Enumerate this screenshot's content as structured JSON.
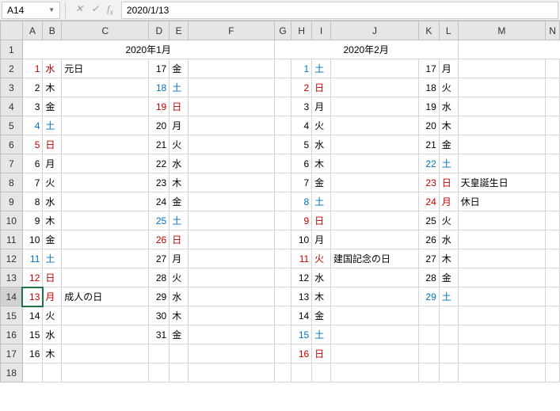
{
  "nameBox": "A14",
  "formula": "2020/1/13",
  "cols": [
    {
      "id": "A",
      "w": 26
    },
    {
      "id": "B",
      "w": 24
    },
    {
      "id": "C",
      "w": 112
    },
    {
      "id": "D",
      "w": 26
    },
    {
      "id": "E",
      "w": 24
    },
    {
      "id": "F",
      "w": 112
    },
    {
      "id": "G",
      "w": 22
    },
    {
      "id": "H",
      "w": 26
    },
    {
      "id": "I",
      "w": 24
    },
    {
      "id": "J",
      "w": 112
    },
    {
      "id": "K",
      "w": 26
    },
    {
      "id": "L",
      "w": 24
    },
    {
      "id": "M",
      "w": 112
    },
    {
      "id": "N",
      "w": 18
    }
  ],
  "rows": 18,
  "activeCell": {
    "r": 14,
    "c": "A"
  },
  "titles": {
    "jan": "2020年1月",
    "feb": "2020年2月"
  },
  "days": {
    "sun": "日",
    "mon": "月",
    "tue": "火",
    "wed": "水",
    "thu": "木",
    "fri": "金",
    "sat": "土"
  },
  "jan1": [
    {
      "d": 1,
      "w": "wed",
      "c": "red",
      "name": "元日"
    },
    {
      "d": 2,
      "w": "thu"
    },
    {
      "d": 3,
      "w": "fri"
    },
    {
      "d": 4,
      "w": "sat",
      "c": "blue"
    },
    {
      "d": 5,
      "w": "sun",
      "c": "red"
    },
    {
      "d": 6,
      "w": "mon"
    },
    {
      "d": 7,
      "w": "tue"
    },
    {
      "d": 8,
      "w": "wed"
    },
    {
      "d": 9,
      "w": "thu"
    },
    {
      "d": 10,
      "w": "fri"
    },
    {
      "d": 11,
      "w": "sat",
      "c": "blue"
    },
    {
      "d": 12,
      "w": "sun",
      "c": "red"
    },
    {
      "d": 13,
      "w": "mon",
      "c": "red",
      "name": "成人の日"
    },
    {
      "d": 14,
      "w": "tue"
    },
    {
      "d": 15,
      "w": "wed"
    },
    {
      "d": 16,
      "w": "thu"
    }
  ],
  "jan2": [
    {
      "d": 17,
      "w": "fri"
    },
    {
      "d": 18,
      "w": "sat",
      "c": "blue"
    },
    {
      "d": 19,
      "w": "sun",
      "c": "red"
    },
    {
      "d": 20,
      "w": "mon"
    },
    {
      "d": 21,
      "w": "tue"
    },
    {
      "d": 22,
      "w": "wed"
    },
    {
      "d": 23,
      "w": "thu"
    },
    {
      "d": 24,
      "w": "fri"
    },
    {
      "d": 25,
      "w": "sat",
      "c": "blue"
    },
    {
      "d": 26,
      "w": "sun",
      "c": "red"
    },
    {
      "d": 27,
      "w": "mon"
    },
    {
      "d": 28,
      "w": "tue"
    },
    {
      "d": 29,
      "w": "wed"
    },
    {
      "d": 30,
      "w": "thu"
    },
    {
      "d": 31,
      "w": "fri"
    }
  ],
  "feb1": [
    {
      "d": 1,
      "w": "sat",
      "c": "blue"
    },
    {
      "d": 2,
      "w": "sun",
      "c": "red"
    },
    {
      "d": 3,
      "w": "mon"
    },
    {
      "d": 4,
      "w": "tue"
    },
    {
      "d": 5,
      "w": "wed"
    },
    {
      "d": 6,
      "w": "thu"
    },
    {
      "d": 7,
      "w": "fri"
    },
    {
      "d": 8,
      "w": "sat",
      "c": "blue"
    },
    {
      "d": 9,
      "w": "sun",
      "c": "red"
    },
    {
      "d": 10,
      "w": "mon"
    },
    {
      "d": 11,
      "w": "tue",
      "c": "red",
      "name": "建国記念の日"
    },
    {
      "d": 12,
      "w": "wed"
    },
    {
      "d": 13,
      "w": "thu"
    },
    {
      "d": 14,
      "w": "fri"
    },
    {
      "d": 15,
      "w": "sat",
      "c": "blue"
    },
    {
      "d": 16,
      "w": "sun",
      "c": "red"
    }
  ],
  "feb2": [
    {
      "d": 17,
      "w": "mon"
    },
    {
      "d": 18,
      "w": "tue"
    },
    {
      "d": 19,
      "w": "wed"
    },
    {
      "d": 20,
      "w": "thu"
    },
    {
      "d": 21,
      "w": "fri"
    },
    {
      "d": 22,
      "w": "sat",
      "c": "blue"
    },
    {
      "d": 23,
      "w": "sun",
      "c": "red",
      "name": "天皇誕生日"
    },
    {
      "d": 24,
      "w": "mon",
      "c": "red",
      "name": "休日"
    },
    {
      "d": 25,
      "w": "tue"
    },
    {
      "d": 26,
      "w": "wed"
    },
    {
      "d": 27,
      "w": "thu"
    },
    {
      "d": 28,
      "w": "fri"
    },
    {
      "d": 29,
      "w": "sat",
      "c": "blue"
    }
  ]
}
